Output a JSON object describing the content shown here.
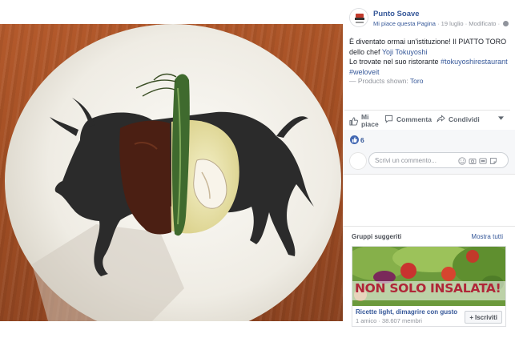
{
  "post": {
    "page_name": "Punto Soave",
    "like_page": "Mi piace questa Pagina",
    "date": "19 luglio",
    "modified": "Modificato",
    "text_line1": "È diventato ormai un'istituzione! Il PIATTO TORO",
    "text_line2_prefix": "dello chef ",
    "chef_link": "Yoji Tokuyoshi",
    "text_line3_prefix": "Lo trovate nel suo ristorante ",
    "hashtag1": "#tokuyoshirestaurant",
    "hashtag2": "#weloveit",
    "products_prefix": "— Products shown: ",
    "products_link": "Toro"
  },
  "actions": {
    "like_label_1": "Mi",
    "like_label_2": "piace",
    "comment_label": "Commenta",
    "share_label": "Condividi"
  },
  "reactions": {
    "count": "6"
  },
  "comment": {
    "placeholder": "Scrivi un commento..."
  },
  "suggested_groups": {
    "title": "Gruppi suggeriti",
    "see_all": "Mostra tutti",
    "cover_text": "NON SOLO INSALATA!",
    "group_name": "Ricette light, dimagrire con gusto",
    "members": "1 amico · 38.607 membri",
    "join_label": "Iscriviti"
  },
  "colors": {
    "link": "#365899",
    "meta": "#90949c",
    "accent": "#4267b2"
  },
  "icons": [
    "globe-icon",
    "thumbs-up-icon",
    "comment-icon",
    "share-icon",
    "caret-down-icon",
    "emoji-icon",
    "camera-icon",
    "gif-icon",
    "sticker-icon",
    "plus-icon"
  ]
}
